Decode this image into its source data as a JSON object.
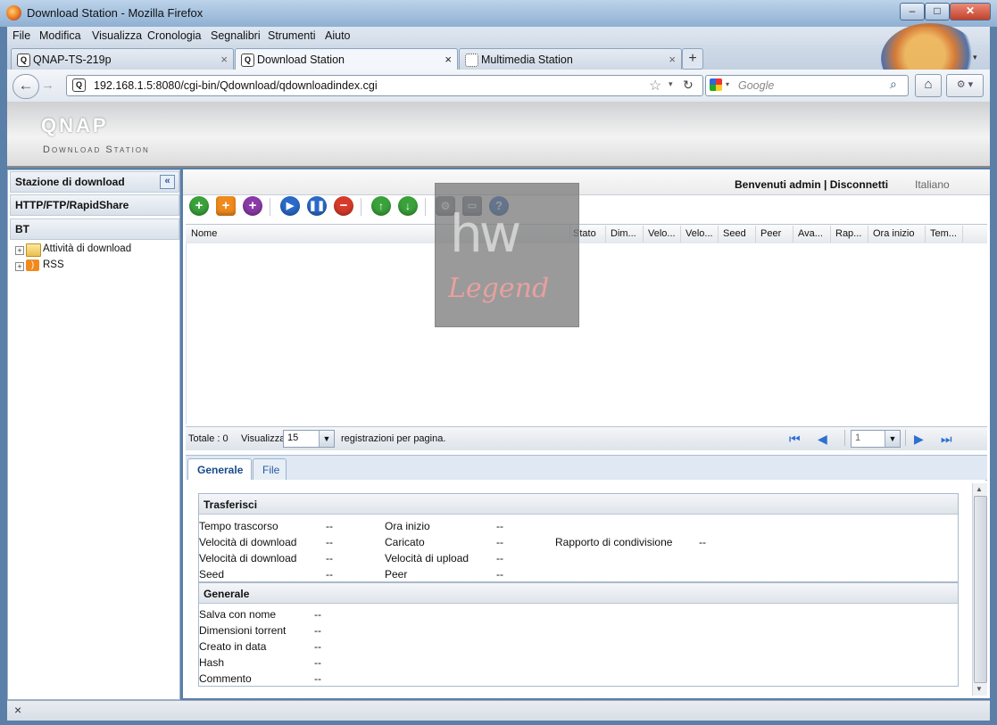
{
  "window": {
    "title": "Download Station - Mozilla Firefox"
  },
  "menu": [
    "File",
    "Modifica",
    "Visualizza",
    "Cronologia",
    "Segnalibri",
    "Strumenti",
    "Aiuto"
  ],
  "tabs": [
    {
      "label": "QNAP-TS-219p"
    },
    {
      "label": "Download Station"
    },
    {
      "label": "Multimedia Station"
    }
  ],
  "nav": {
    "url": "192.168.1.5:8080/cgi-bin/Qdownload/qdownloadindex.cgi",
    "search_placeholder": "Google"
  },
  "app": {
    "brand": "QNAP",
    "subtitle": "Download Station"
  },
  "sidebar": {
    "title": "Stazione di download",
    "sections": [
      "HTTP/FTP/RapidShare",
      "BT"
    ],
    "tree": [
      {
        "label": "Attività di download"
      },
      {
        "label": "RSS"
      }
    ]
  },
  "topline": {
    "welcome": "Benvenuti admin | Disconnetti",
    "language": "Italiano"
  },
  "grid": {
    "columns": [
      "Nome",
      "Stato",
      "Dim...",
      "Velo...",
      "Velo...",
      "Seed",
      "Peer",
      "Ava...",
      "Rap...",
      "Ora inizio",
      "Tem..."
    ]
  },
  "pager": {
    "total": "Totale : 0",
    "view_label": "Visualizza",
    "per_page": "15",
    "per_page_suffix": "registrazioni per pagina.",
    "page": "1"
  },
  "details": {
    "tabs": [
      "Generale",
      "File"
    ],
    "transfer": {
      "title": "Trasferisci",
      "rows": [
        [
          "Tempo trascorso",
          "--",
          "Ora inizio",
          "--"
        ],
        [
          "Velocità di download",
          "--",
          "Caricato",
          "--"
        ],
        [
          "Velocità di download",
          "--",
          "Velocità di upload",
          "--"
        ],
        [
          "Seed",
          "--",
          "Peer",
          "--"
        ]
      ],
      "ratio_label": "Rapporto di condivisione",
      "ratio_value": "--"
    },
    "general": {
      "title": "Generale",
      "rows": [
        [
          "Salva con nome",
          "--"
        ],
        [
          "Dimensioni torrent",
          "--"
        ],
        [
          "Creato in data",
          "--"
        ],
        [
          "Hash",
          "--"
        ],
        [
          "Commento",
          "--"
        ]
      ]
    }
  },
  "watermark": {
    "text": "Legend"
  },
  "statusbar": {
    "close_glyph": "×"
  }
}
